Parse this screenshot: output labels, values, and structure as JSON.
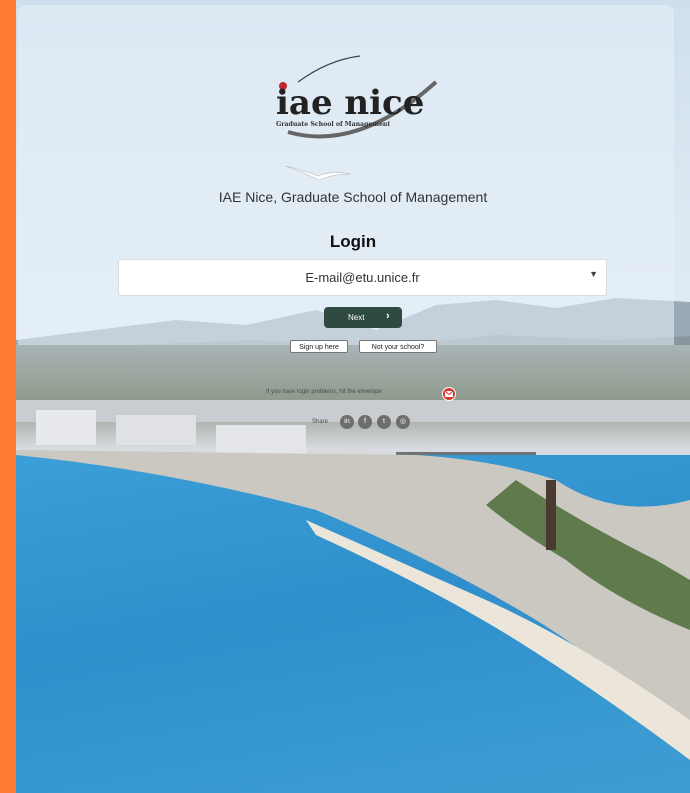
{
  "logo": {
    "main": "iae  nice",
    "tagline": "Graduate School of Management"
  },
  "school_name": "IAE Nice, Graduate School of Management",
  "login": {
    "title": "Login",
    "email_selected": "E-mail@etu.unice.fr",
    "next_label": "Next"
  },
  "links": {
    "signup": "Sign up here",
    "not_your_school": "Not your school?"
  },
  "help": {
    "text": "If you have login problems, hit the envelope"
  },
  "share": {
    "label": "Share",
    "icons": [
      "linkedin-icon",
      "facebook-icon",
      "twitter-icon",
      "share-icon"
    ]
  },
  "colors": {
    "accent_orange": "#ff7a33",
    "button_green": "#2f4a40",
    "envelope_red": "#d8372f"
  }
}
